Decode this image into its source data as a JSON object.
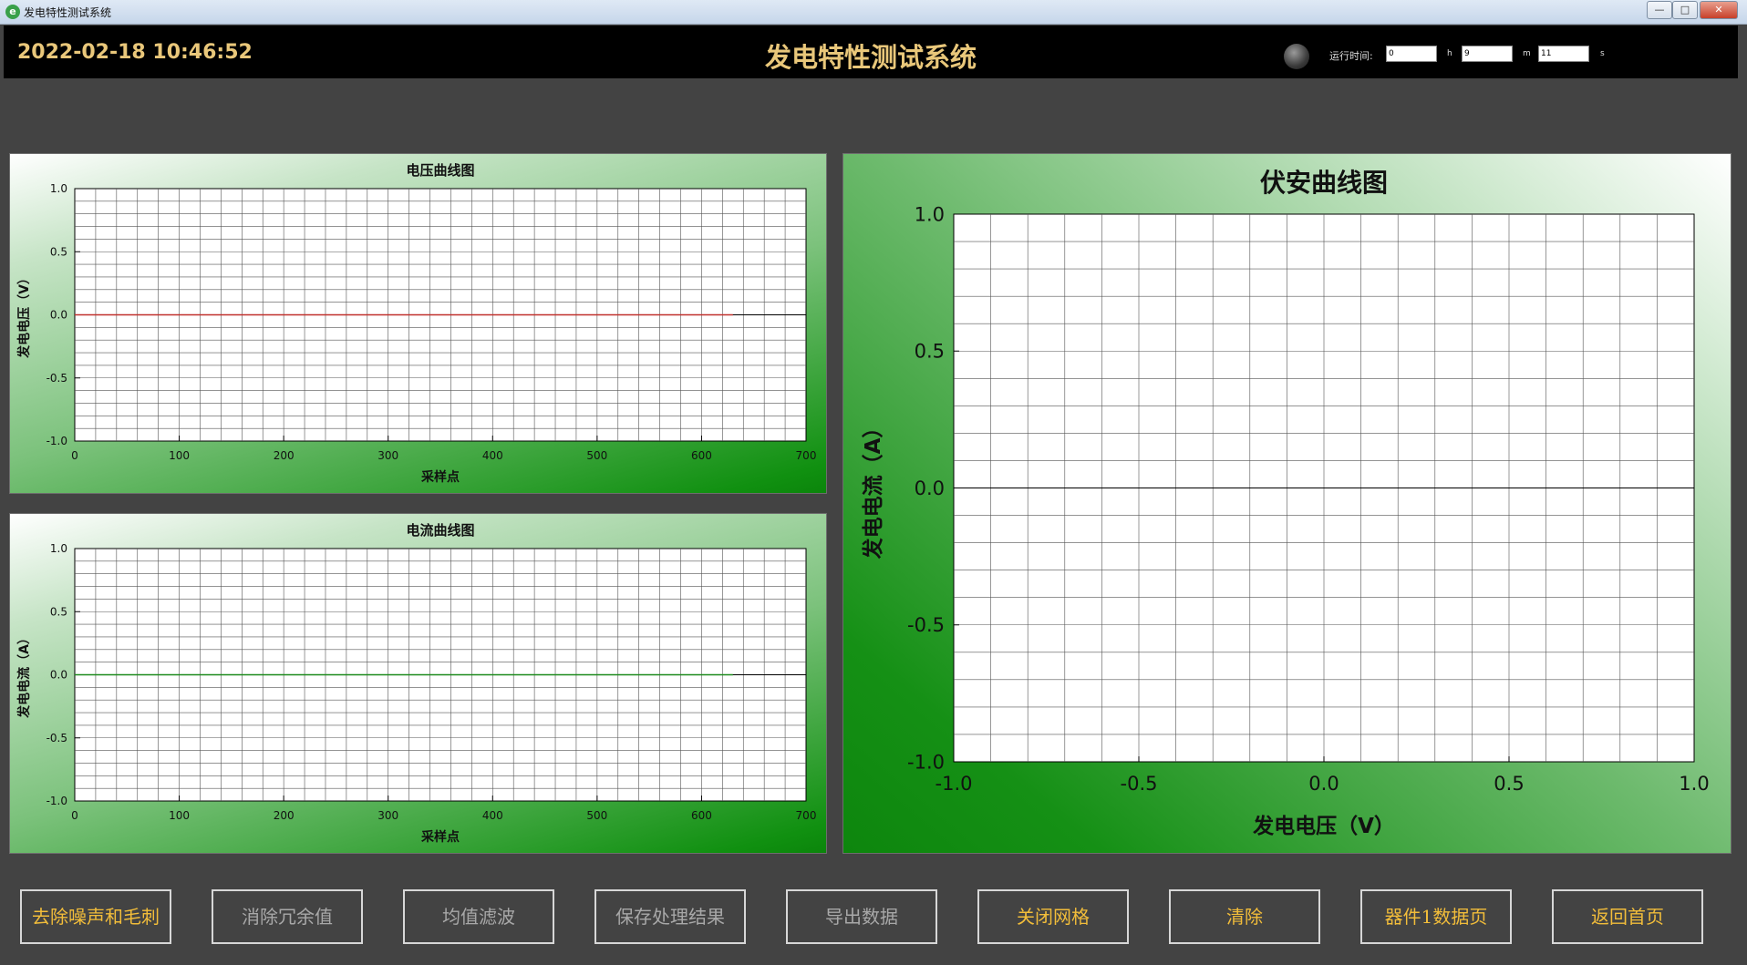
{
  "window": {
    "title": "发电特性测试系统",
    "controls": {
      "minimize": "—",
      "maximize": "□",
      "close": "✕"
    }
  },
  "header": {
    "datetime": "2022-02-18 10:46:52",
    "title": "发电特性测试系统",
    "runtime": {
      "label": "运行时间:",
      "hours": "0",
      "hours_unit": "h",
      "minutes": "9",
      "minutes_unit": "m",
      "seconds": "11",
      "seconds_unit": "s"
    }
  },
  "colors": {
    "accent_gold": "#e9c77a",
    "button_gold": "#f2bd3a",
    "button_grey": "#a8a8a8",
    "voltage_trace": "#c0302c",
    "current_trace": "#1c8a1c"
  },
  "chart_data": [
    {
      "type": "line",
      "title": "电压曲线图",
      "xlabel": "采样点",
      "ylabel": "发电电压（V）",
      "xlim": [
        0,
        700
      ],
      "ylim": [
        -1.0,
        1.0
      ],
      "x_ticks": [
        "0",
        "100",
        "200",
        "300",
        "400",
        "500",
        "600",
        "700"
      ],
      "y_ticks": [
        "1.0",
        "0.5",
        "0.0",
        "-0.5",
        "-1.0"
      ],
      "grid": true,
      "series": [
        {
          "color": "#c0302c",
          "x": [
            0,
            630
          ],
          "y": [
            0.0,
            0.0
          ]
        }
      ]
    },
    {
      "type": "line",
      "title": "电流曲线图",
      "xlabel": "采样点",
      "ylabel": "发电电流（A）",
      "xlim": [
        0,
        700
      ],
      "ylim": [
        -1.0,
        1.0
      ],
      "x_ticks": [
        "0",
        "100",
        "200",
        "300",
        "400",
        "500",
        "600",
        "700"
      ],
      "y_ticks": [
        "1.0",
        "0.5",
        "0.0",
        "-0.5",
        "-1.0"
      ],
      "grid": true,
      "series": [
        {
          "color": "#1c8a1c",
          "x": [
            0,
            630
          ],
          "y": [
            0.0,
            0.0
          ]
        }
      ]
    },
    {
      "type": "scatter",
      "title": "伏安曲线图",
      "xlabel": "发电电压（V）",
      "ylabel": "发电电流（A）",
      "xlim": [
        -1.0,
        1.0
      ],
      "ylim": [
        -1.0,
        1.0
      ],
      "x_ticks": [
        "-1.0",
        "-0.5",
        "0.0",
        "0.5",
        "1.0"
      ],
      "y_ticks": [
        "1.0",
        "0.5",
        "0.0",
        "-0.5",
        "-1.0"
      ],
      "grid": true,
      "series": []
    }
  ],
  "buttons": [
    {
      "label": "去除噪声和毛刺",
      "style": "gold"
    },
    {
      "label": "消除冗余值",
      "style": "grey"
    },
    {
      "label": "均值滤波",
      "style": "grey"
    },
    {
      "label": "保存处理结果",
      "style": "grey"
    },
    {
      "label": "导出数据",
      "style": "grey"
    },
    {
      "label": "关闭网格",
      "style": "gold"
    },
    {
      "label": "清除",
      "style": "gold"
    },
    {
      "label": "器件1数据页",
      "style": "gold"
    },
    {
      "label": "返回首页",
      "style": "gold"
    }
  ]
}
